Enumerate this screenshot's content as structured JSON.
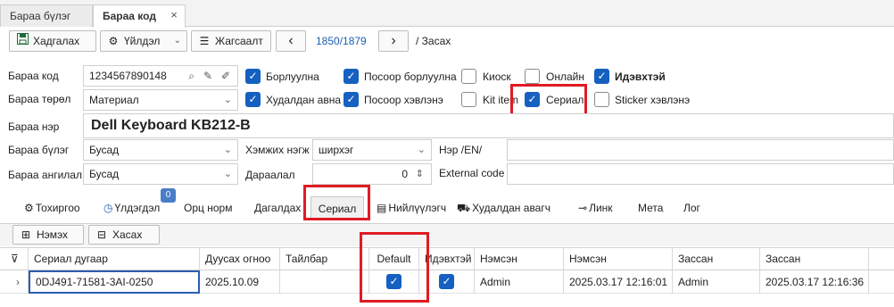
{
  "tabs": [
    {
      "label": "Бараа бүлэг"
    },
    {
      "label": "Бараа код"
    }
  ],
  "toolbar": {
    "save_label": "Хадгалах",
    "action_label": "Үйлдэл",
    "list_label": "Жагсаалт",
    "record_counter": "1850/1879",
    "mode_label": "/ Засах"
  },
  "form": {
    "code_label": "Бараа код",
    "code_value": "1234567890148",
    "type_label": "Бараа төрөл",
    "type_value": "Материал",
    "name_label": "Бараа нэр",
    "name_value": "Dell Keyboard KB212-B",
    "group_label": "Бараа бүлэг",
    "group_value": "Бусад",
    "unit_label": "Хэмжих нэгж",
    "unit_value": "ширхэг",
    "name_en_label": "Нэр /EN/",
    "name_en_value": "",
    "class_label": "Бараа ангилал",
    "class_value": "Бусад",
    "order_label": "Дараалал",
    "order_value": "0",
    "external_label": "External code",
    "external_value": ""
  },
  "checks": {
    "sell": {
      "label": "Борлуулна",
      "checked": true
    },
    "pos_sell": {
      "label": "Посоор борлуулна",
      "checked": true
    },
    "kiosk": {
      "label": "Киоск",
      "checked": false
    },
    "online": {
      "label": "Онлайн",
      "checked": false
    },
    "active": {
      "label": "Идэвхтэй",
      "checked": true
    },
    "buy": {
      "label": "Худалдан авна",
      "checked": true
    },
    "pos_print": {
      "label": "Посоор хэвлэнэ",
      "checked": true
    },
    "kit": {
      "label": "Kit item",
      "checked": false
    },
    "serial": {
      "label": "Сериал",
      "checked": true
    },
    "sticker": {
      "label": "Sticker хэвлэнэ",
      "checked": false
    }
  },
  "subtabs": [
    {
      "label": "Тохиргоо",
      "icon": "gear-icon"
    },
    {
      "label": "Үлдэгдэл",
      "icon": "clock-icon",
      "badge": "0"
    },
    {
      "label": "Орц норм"
    },
    {
      "label": "Дагалдах"
    },
    {
      "label": "Сериал"
    },
    {
      "label": "Нийлүүлэгч",
      "icon": "document-icon"
    },
    {
      "label": "Худалдан авагч",
      "icon": "cart-icon"
    },
    {
      "label": "Линк",
      "icon": "link-icon"
    },
    {
      "label": "Мета"
    },
    {
      "label": "Лог"
    }
  ],
  "grid_toolbar": {
    "add_label": "Нэмэх",
    "remove_label": "Хасах"
  },
  "grid": {
    "columns": [
      "Сериал дугаар",
      "Дуусах огноо",
      "Тайлбар",
      "Default",
      "Идэвхтэй",
      "Нэмсэн",
      "Нэмсэн",
      "Зассан",
      "Зассан"
    ],
    "rows": [
      {
        "serial": "0DJ491-71581-3AI-0250",
        "expiry": "2025.10.09",
        "note": "",
        "default": true,
        "active": true,
        "added_by": "Admin",
        "added_at": "2025.03.17 12:16:01",
        "edited_by": "Admin",
        "edited_at": "2025.03.17 12:16:36"
      }
    ]
  }
}
